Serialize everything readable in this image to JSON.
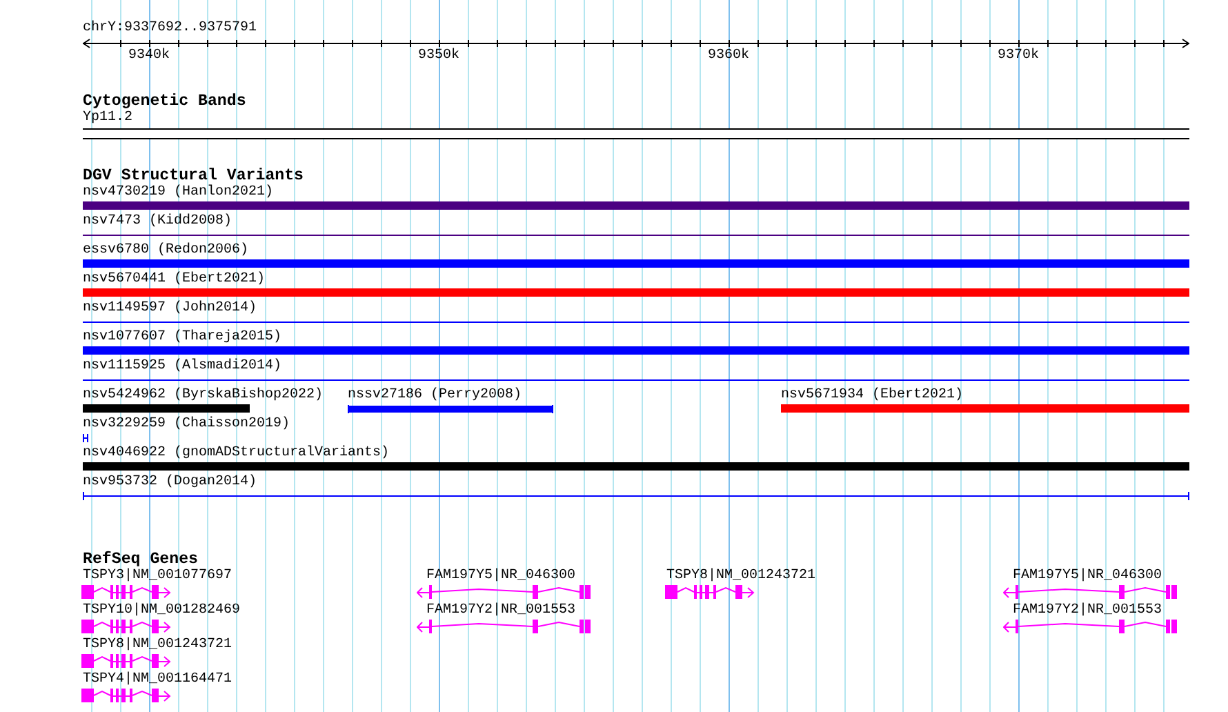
{
  "ruler": {
    "location": "chrY:9337692..9375791",
    "ticks": [
      "9340k",
      "9350k",
      "9360k",
      "9370k"
    ]
  },
  "cytogenetic_bands": {
    "title": "Cytogenetic Bands",
    "bands": [
      {
        "label": "Yp11.2"
      }
    ]
  },
  "structural_variants": {
    "title": "DGV Structural Variants",
    "rows": [
      [
        {
          "label": "nsv4730219 (Hanlon2021)",
          "color": "#4b0082",
          "kind": "bar",
          "capped": false
        }
      ],
      [
        {
          "label": "nsv7473 (Kidd2008)",
          "color": "#4b0082",
          "kind": "line",
          "capped": false
        }
      ],
      [
        {
          "label": "essv6780 (Redon2006)",
          "color": "#0000ff",
          "kind": "bar",
          "capped": false
        }
      ],
      [
        {
          "label": "nsv5670441 (Ebert2021)",
          "color": "#ff0000",
          "kind": "bar",
          "capped": false
        }
      ],
      [
        {
          "label": "nsv1149597 (John2014)",
          "color": "#0000ff",
          "kind": "line",
          "capped": false
        }
      ],
      [
        {
          "label": "nsv1077607 (Thareja2015)",
          "color": "#0000ff",
          "kind": "bar",
          "capped": false
        }
      ],
      [
        {
          "label": "nsv1115925 (Alsmadi2014)",
          "color": "#0000ff",
          "kind": "line",
          "capped": false
        }
      ],
      [
        {
          "label": "nsv5424962 (ByrskaBishop2022)",
          "color": "#000000",
          "kind": "bar",
          "capped": false
        },
        {
          "label": "nssv27186 (Perry2008)",
          "color": "#0000ff",
          "kind": "bar",
          "capped": true
        },
        {
          "label": "nsv5671934 (Ebert2021)",
          "color": "#ff0000",
          "kind": "bar",
          "capped": false
        }
      ],
      [
        {
          "label": "nsv3229259 (Chaisson2019)",
          "color": "#0000ff",
          "kind": "line",
          "capped": true
        }
      ],
      [
        {
          "label": "nsv4046922 (gnomADStructuralVariants)",
          "color": "#000000",
          "kind": "bar",
          "capped": false
        }
      ],
      [
        {
          "label": "nsv953732 (Dogan2014)",
          "color": "#0000ff",
          "kind": "line",
          "capped": true
        }
      ]
    ]
  },
  "refseq_genes": {
    "title": "RefSeq Genes",
    "loci": [
      {
        "genes": [
          {
            "label": "TSPY3|NM_001077697",
            "kind": "forward"
          },
          {
            "label": "TSPY10|NM_001282469",
            "kind": "forward"
          },
          {
            "label": "TSPY8|NM_001243721",
            "kind": "forward"
          },
          {
            "label": "TSPY4|NM_001164471",
            "kind": "forward"
          }
        ]
      },
      {
        "genes": [
          {
            "label": "FAM197Y5|NR_046300",
            "kind": "reverse"
          },
          {
            "label": "FAM197Y2|NR_001553",
            "kind": "reverse"
          }
        ]
      },
      {
        "genes": [
          {
            "label": "TSPY8|NM_001243721",
            "kind": "forward"
          }
        ]
      },
      {
        "genes": [
          {
            "label": "FAM197Y5|NR_046300",
            "kind": "reverse"
          },
          {
            "label": "FAM197Y2|NR_001553",
            "kind": "reverse"
          }
        ]
      }
    ]
  }
}
